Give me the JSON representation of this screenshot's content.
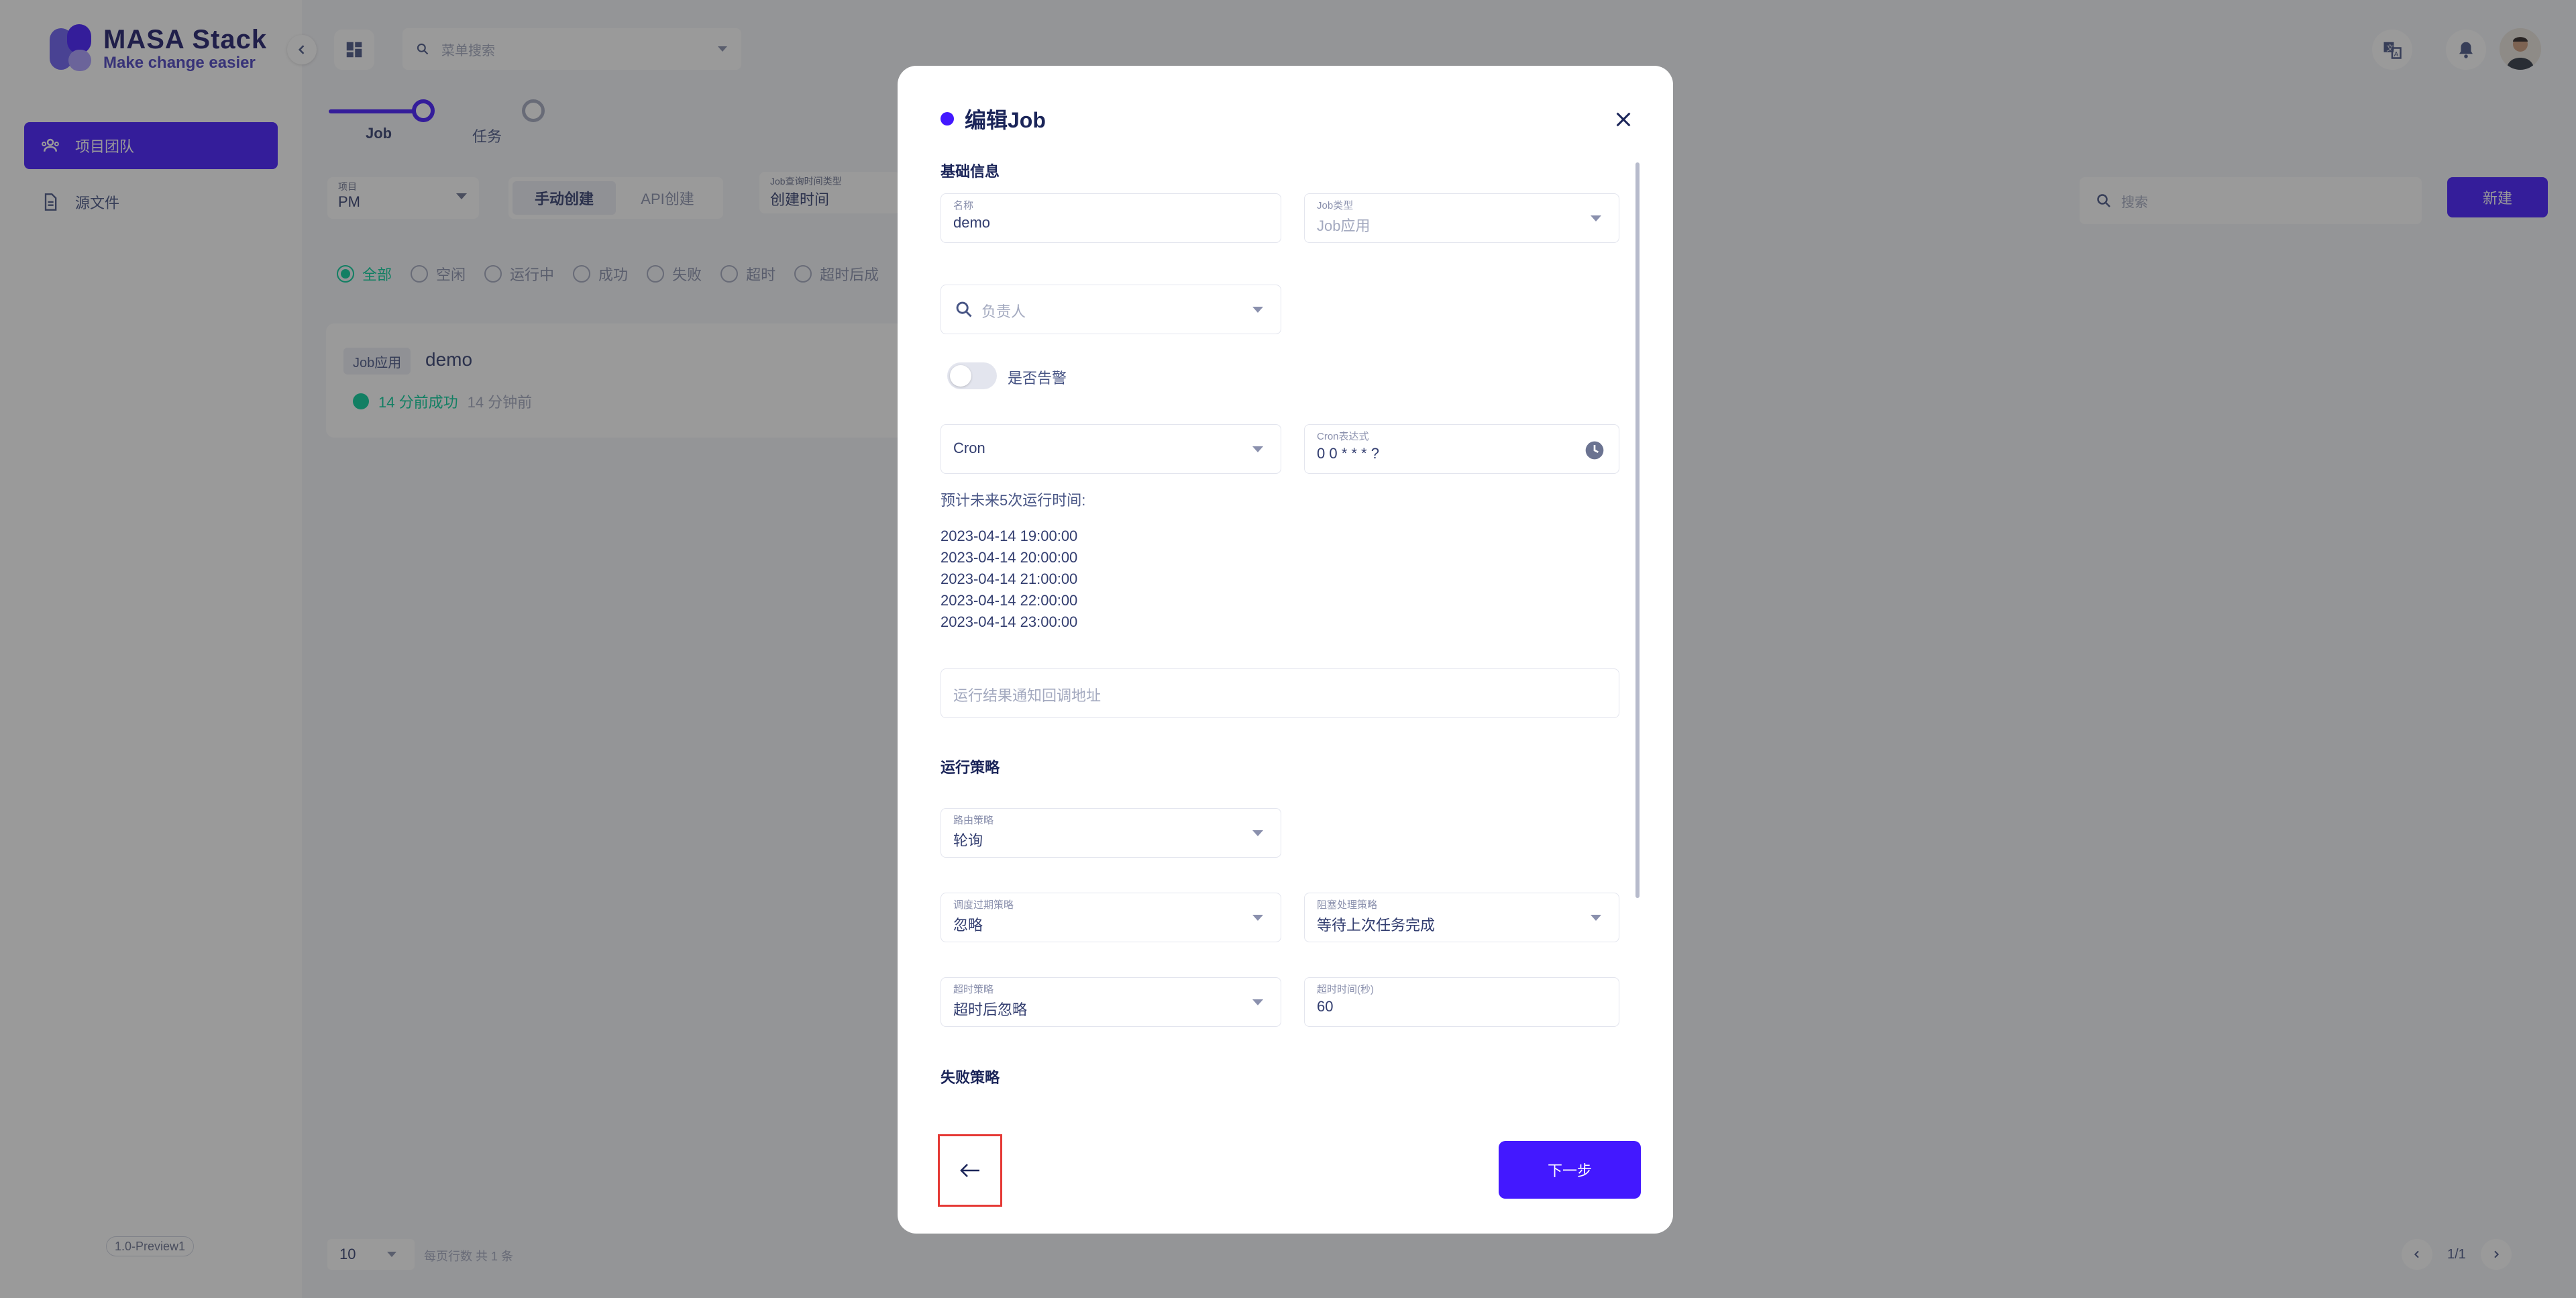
{
  "app": {
    "logo_title": "MASA Stack",
    "logo_subtitle": "Make change easier",
    "version": "1.0-Preview1",
    "brand_color": "#4318ff",
    "success_color": "#05cd99"
  },
  "sidebar": {
    "items": [
      {
        "label": "项目团队",
        "icon": "team-icon",
        "active": true
      },
      {
        "label": "源文件",
        "icon": "file-icon",
        "active": false
      }
    ]
  },
  "header": {
    "search_placeholder": "菜单搜索"
  },
  "stepper": {
    "steps": [
      {
        "label": "Job"
      },
      {
        "label": "任务"
      }
    ]
  },
  "filters": {
    "project": {
      "label": "项目",
      "value": "PM"
    },
    "create_tabs": [
      "手动创建",
      "API创建"
    ],
    "time_type": {
      "label": "Job查询时间类型",
      "value": "创建时间"
    },
    "status_options": [
      "全部",
      "空闲",
      "运行中",
      "成功",
      "失败",
      "超时",
      "超时后成"
    ],
    "search_placeholder": "搜索",
    "new_button": "新建"
  },
  "job_card": {
    "type_chip": "Job应用",
    "name": "demo",
    "status": "14 分前成功",
    "time": "14 分钟前"
  },
  "pagination": {
    "page_size": "10",
    "info": "每页行数  共 1 条",
    "page": "1/1"
  },
  "dialog": {
    "title": "编辑Job",
    "sections": {
      "basic": "基础信息",
      "run": "运行策略",
      "fail": "失败策略"
    },
    "name": {
      "label": "名称",
      "value": "demo"
    },
    "job_type": {
      "label": "Job类型",
      "value": "Job应用"
    },
    "owner": {
      "placeholder": "负责人"
    },
    "alert": {
      "label": "是否告警"
    },
    "schedule_type": {
      "value": "Cron"
    },
    "cron": {
      "label": "Cron表达式",
      "value": "0 0 * * * ?"
    },
    "preview": {
      "title": "预计未来5次运行时间:",
      "times": [
        "2023-04-14 19:00:00",
        "2023-04-14 20:00:00",
        "2023-04-14 21:00:00",
        "2023-04-14 22:00:00",
        "2023-04-14 23:00:00"
      ]
    },
    "callback": {
      "placeholder": "运行结果通知回调地址"
    },
    "route": {
      "label": "路由策略",
      "value": "轮询"
    },
    "misfire": {
      "label": "调度过期策略",
      "value": "忽略"
    },
    "block": {
      "label": "阻塞处理策略",
      "value": "等待上次任务完成"
    },
    "timeout_strategy": {
      "label": "超时策略",
      "value": "超时后忽略"
    },
    "timeout_seconds": {
      "label": "超时时间(秒)",
      "value": "60"
    },
    "next_button": "下一步"
  }
}
